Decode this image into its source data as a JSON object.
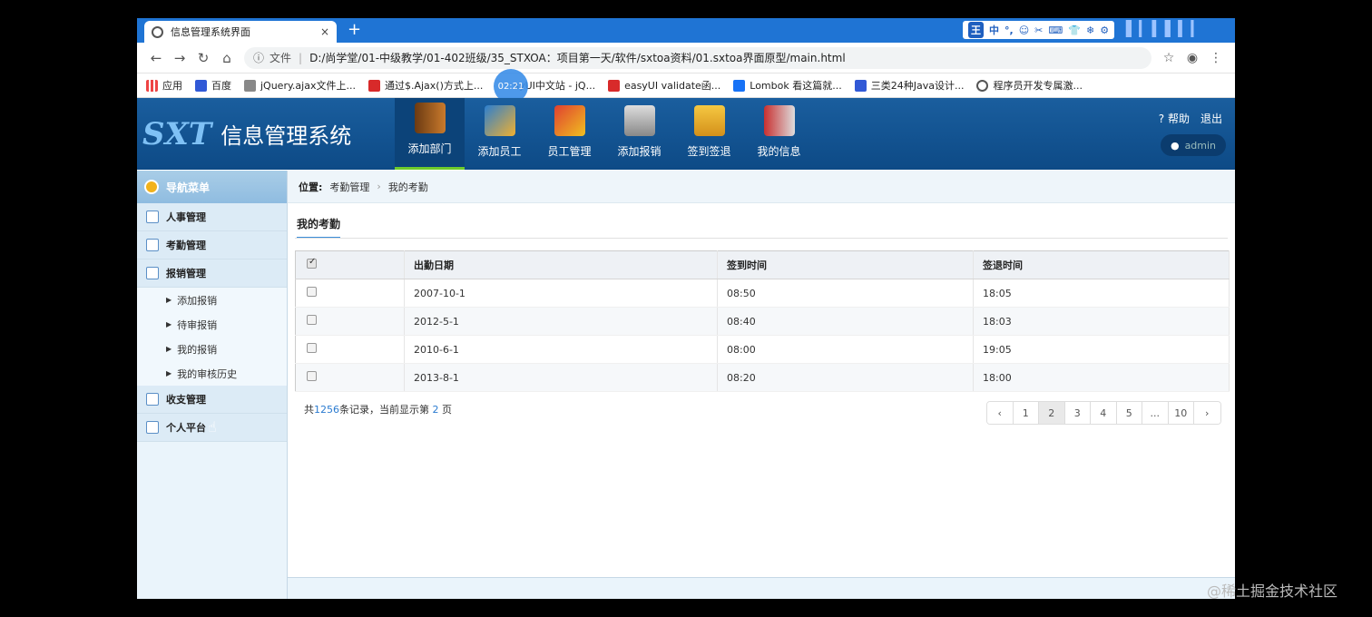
{
  "browser": {
    "tab_title": "信息管理系统界面",
    "tab_close": "×",
    "new_tab": "+",
    "file_label": "文件",
    "url": "D:/尚学堂/01-中级教学/01-402班级/35_STXOA：项目第一天/软件/sxtoa资料/01.sxtoa界面原型/main.html",
    "time_badge": "02:21",
    "ime": [
      "王",
      "中",
      "°,",
      "☺",
      "✂",
      "⌨",
      "👕",
      "❄",
      "⚙"
    ],
    "bookmarks": [
      "应用",
      "百度",
      "jQuery.ajax文件上...",
      "通过$.Ajax()方式上...",
      "syUI中文站 - jQ...",
      "easyUI validate函...",
      "Lombok 看这篇就...",
      "三类24种Java设计...",
      "程序员开发专属激..."
    ]
  },
  "header": {
    "logo": "SXT",
    "title": "信息管理系统",
    "nav": [
      "添加部门",
      "添加员工",
      "员工管理",
      "添加报销",
      "签到签退",
      "我的信息"
    ],
    "help": "帮助",
    "logout": "退出",
    "user": "admin"
  },
  "sidebar": {
    "head": "导航菜单",
    "menus": [
      "人事管理",
      "考勤管理",
      "报销管理"
    ],
    "submenus": [
      "添加报销",
      "待审报销",
      "我的报销",
      "我的审核历史"
    ],
    "menus2": [
      "收支管理",
      "个人平台"
    ]
  },
  "content": {
    "crumb_label": "位置:",
    "crumb1": "考勤管理",
    "crumb_sep": "›",
    "crumb2": "我的考勤",
    "panel_title": "我的考勤",
    "columns": [
      "出勤日期",
      "签到时间",
      "签退时间"
    ],
    "rows": [
      [
        "2007-10-1",
        "08:50",
        "18:05"
      ],
      [
        "2012-5-1",
        "08:40",
        "18:03"
      ],
      [
        "2010-6-1",
        "08:00",
        "19:05"
      ],
      [
        "2013-8-1",
        "08:20",
        "18:00"
      ]
    ],
    "page_info_prefix": "共",
    "total": "1256",
    "page_info_mid": "条记录，当前显示第",
    "current_page": "2",
    "page_info_suffix": "页",
    "pager": [
      "‹",
      "1",
      "2",
      "3",
      "4",
      "5",
      "...",
      "10",
      "›"
    ]
  },
  "watermark": "@稀土掘金技术社区",
  "colors": {
    "chrome": "#1f74d4",
    "header": "#0d4a86",
    "active_tab": "#6ecb2b",
    "sidebar": "#eaf4fb"
  }
}
